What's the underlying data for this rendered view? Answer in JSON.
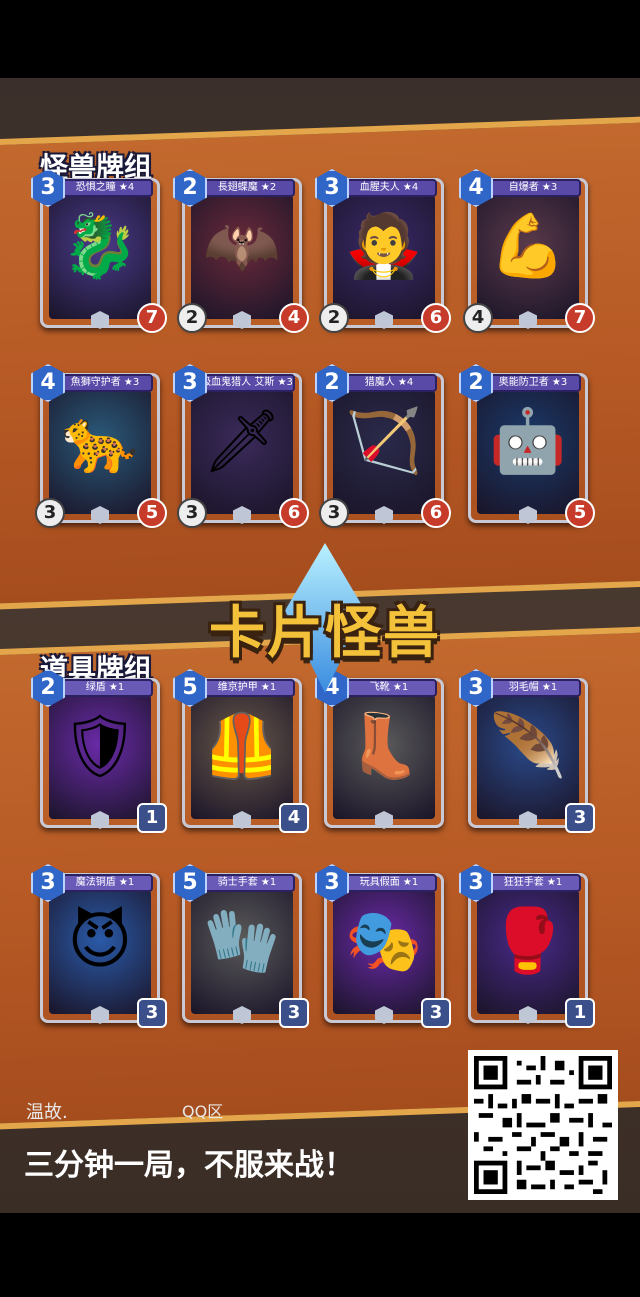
{
  "sections": {
    "monsters_title": "怪兽牌组",
    "items_title": "道具牌组"
  },
  "logo": {
    "text": "卡片怪兽"
  },
  "monster_cards": [
    {
      "name": "恐惧之瞳 ★4",
      "cost": "3",
      "hp": "7",
      "glyph": "🐉",
      "bg": "#4a3a8a"
    },
    {
      "name": "長翅蝶魔 ★2",
      "cost": "2",
      "hp": "4",
      "atk": "2",
      "glyph": "🦇",
      "bg": "#6a2a3a"
    },
    {
      "name": "血腥夫人 ★4",
      "cost": "3",
      "hp": "6",
      "atk": "2",
      "glyph": "🧛",
      "bg": "#3a2a6a"
    },
    {
      "name": "自爆者 ★3",
      "cost": "4",
      "hp": "7",
      "atk": "4",
      "glyph": "💪",
      "bg": "#5a3a4a"
    },
    {
      "name": "魚獅守护者 ★3",
      "cost": "4",
      "hp": "5",
      "atk": "3",
      "glyph": "🐆",
      "bg": "#2a5a7a"
    },
    {
      "name": "吸血鬼猎人 艾斯 ★3",
      "cost": "3",
      "hp": "6",
      "atk": "3",
      "glyph": "🗡",
      "bg": "#3a2a5a"
    },
    {
      "name": "猎魔人 ★4",
      "cost": "2",
      "hp": "6",
      "atk": "3",
      "glyph": "🏹",
      "bg": "#2a2a4a"
    },
    {
      "name": "奥能防卫者 ★3",
      "cost": "2",
      "hp": "5",
      "glyph": "🤖",
      "bg": "#1a3a6a"
    }
  ],
  "item_cards": [
    {
      "name": "绿盾 ★1",
      "cost": "2",
      "hp": "1",
      "glyph": "🛡",
      "bg": "#6a2aa8"
    },
    {
      "name": "维京护甲 ★1",
      "cost": "5",
      "hp": "4",
      "glyph": "🦺",
      "bg": "#6a5a4a"
    },
    {
      "name": "飞靴 ★1",
      "cost": "4",
      "hp": "",
      "glyph": "👢",
      "bg": "#5a5a5a"
    },
    {
      "name": "羽毛帽 ★1",
      "cost": "3",
      "hp": "3",
      "glyph": "🪶",
      "bg": "#2a4a8a"
    },
    {
      "name": "魔法铜盾 ★1",
      "cost": "3",
      "hp": "3",
      "glyph": "😈",
      "bg": "#2a5aa8"
    },
    {
      "name": "骑士手套 ★1",
      "cost": "5",
      "hp": "3",
      "glyph": "🧤",
      "bg": "#5a5a5a"
    },
    {
      "name": "玩具假面 ★1",
      "cost": "3",
      "hp": "3",
      "glyph": "🎭",
      "bg": "#6a2aa8"
    },
    {
      "name": "狂狂手套 ★1",
      "cost": "3",
      "hp": "1",
      "glyph": "🥊",
      "bg": "#4a2a8a"
    }
  ],
  "footer": {
    "username": "温故.",
    "zone": "QQ区",
    "slogan": "三分钟一局，不服来战！"
  }
}
